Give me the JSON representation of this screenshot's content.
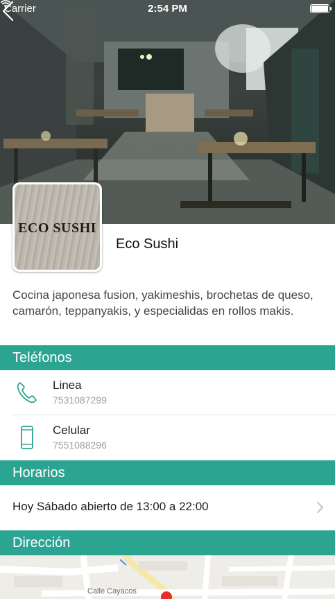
{
  "status_bar": {
    "carrier": "Carrier",
    "time": "2:54 PM"
  },
  "restaurant": {
    "logo_text": "ECO SUSHI",
    "name": "Eco Sushi",
    "description": "Cocina japonesa fusion, yakimeshis, brochetas de queso, camarón, teppanyakis, y especialidas en rollos makis."
  },
  "sections": {
    "phones": "Teléfonos",
    "hours": "Horarios",
    "address": "Dirección"
  },
  "phones": [
    {
      "label": "Linea",
      "number": "7531087299",
      "icon": "phone-handset-icon"
    },
    {
      "label": "Celular",
      "number": "7551088296",
      "icon": "mobile-phone-icon"
    }
  ],
  "hours": {
    "today": "Hoy Sábado abierto de 13:00 a 22:00"
  },
  "map": {
    "street_label": "Calle Cayacos"
  },
  "colors": {
    "accent": "#2ba492",
    "hero_dark": "#2b3235"
  }
}
